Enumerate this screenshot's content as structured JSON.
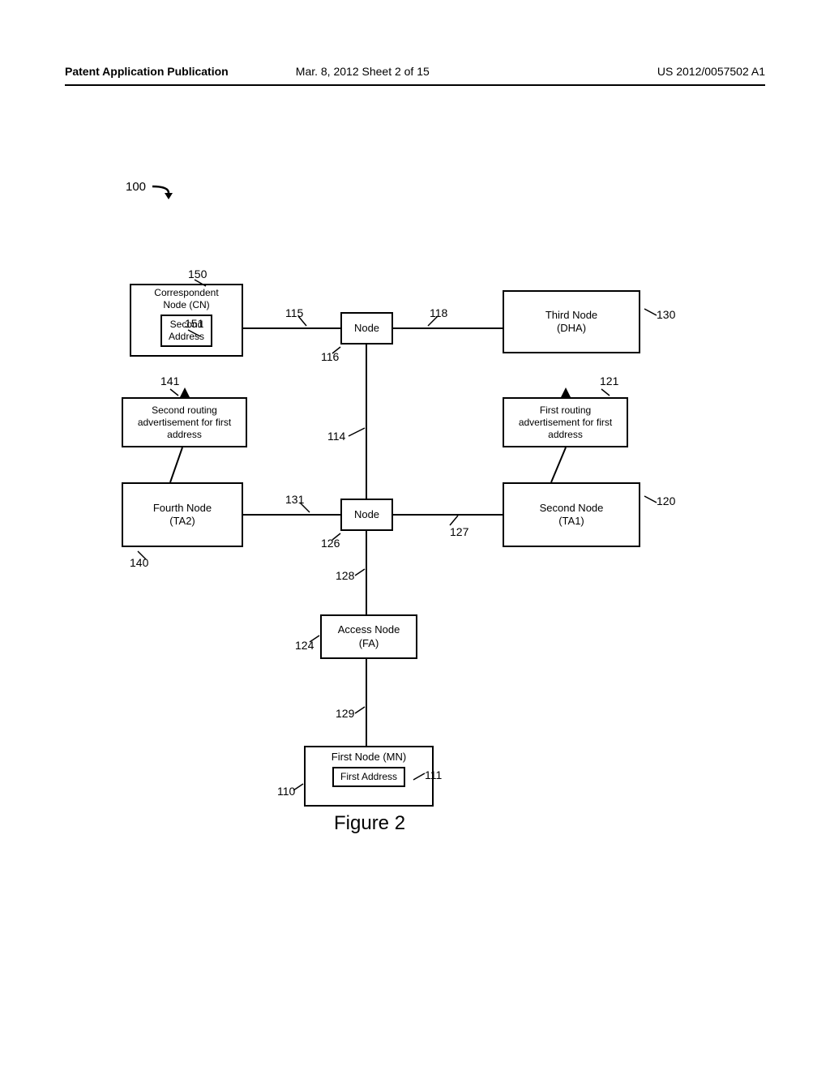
{
  "header": {
    "left": "Patent Application Publication",
    "mid": "Mar. 8, 2012  Sheet 2 of 15",
    "right": "US 2012/0057502 A1"
  },
  "figure": {
    "caption": "Figure 2",
    "system_ref": "100"
  },
  "nodes": {
    "cn": {
      "title": "Correspondent\nNode (CN)",
      "inner": "Second\nAddress",
      "ref": "150",
      "inner_ref": "151"
    },
    "top_node": {
      "title": "Node",
      "ref": "116"
    },
    "dha": {
      "title": "Third Node\n(DHA)",
      "ref": "130"
    },
    "routing2": {
      "title": "Second routing\nadvertisement for first\naddress",
      "ref": "141"
    },
    "routing1": {
      "title": "First routing\nadvertisement for first\naddress",
      "ref": "121"
    },
    "ta2": {
      "title": "Fourth Node\n(TA2)",
      "ref": "140"
    },
    "mid_node": {
      "title": "Node",
      "ref": "126"
    },
    "ta1": {
      "title": "Second Node\n(TA1)",
      "ref": "120"
    },
    "fa": {
      "title": "Access Node\n(FA)",
      "ref": "124"
    },
    "mn": {
      "title": "First Node (MN)",
      "inner": "First Address",
      "ref": "110",
      "inner_ref": "111"
    }
  },
  "edges": {
    "e114": "114",
    "e115": "115",
    "e118": "118",
    "e127": "127",
    "e128": "128",
    "e129": "129",
    "e131": "131"
  }
}
